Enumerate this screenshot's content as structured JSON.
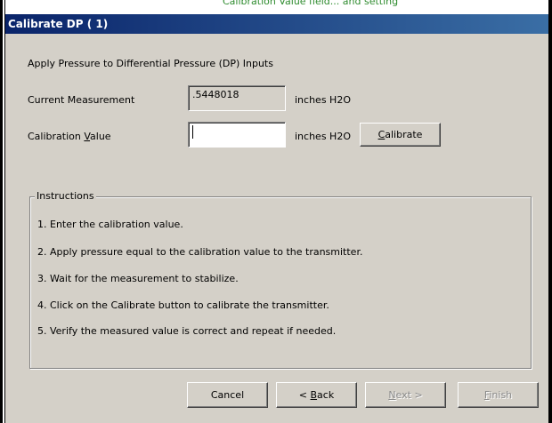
{
  "clipped_header_text": "Calibration Value field... and setting",
  "window": {
    "title": "Calibrate DP ( 1)"
  },
  "heading": "Apply Pressure to Differential Pressure (DP) Inputs",
  "current_measurement": {
    "label": "Current Measurement",
    "value": ".5448018",
    "unit": "inches H2O"
  },
  "calibration_value": {
    "label_pre": "Calibration ",
    "label_accel": "V",
    "label_post": "alue",
    "value": "",
    "unit": "inches H2O"
  },
  "calibrate_button": {
    "accel": "C",
    "rest": "alibrate"
  },
  "instructions": {
    "title": "Instructions",
    "items": [
      "1. Enter the calibration value.",
      "2. Apply pressure equal to the calibration value to the transmitter.",
      "3. Wait for the measurement to stabilize.",
      "4. Click on the Calibrate button to calibrate the transmitter.",
      "5. Verify the measured value is correct and repeat if needed."
    ]
  },
  "footer": {
    "cancel": "Cancel",
    "back_pre": "< ",
    "back_accel": "B",
    "back_post": "ack",
    "next_accel": "N",
    "next_post": "ext >",
    "finish_accel": "F",
    "finish_post": "inish"
  },
  "colors": {
    "titlebar_start": "#0a246a",
    "titlebar_end": "#3a6ea5",
    "dialog_face": "#d4d0c8",
    "clipped_header": "#2e8b2e"
  }
}
